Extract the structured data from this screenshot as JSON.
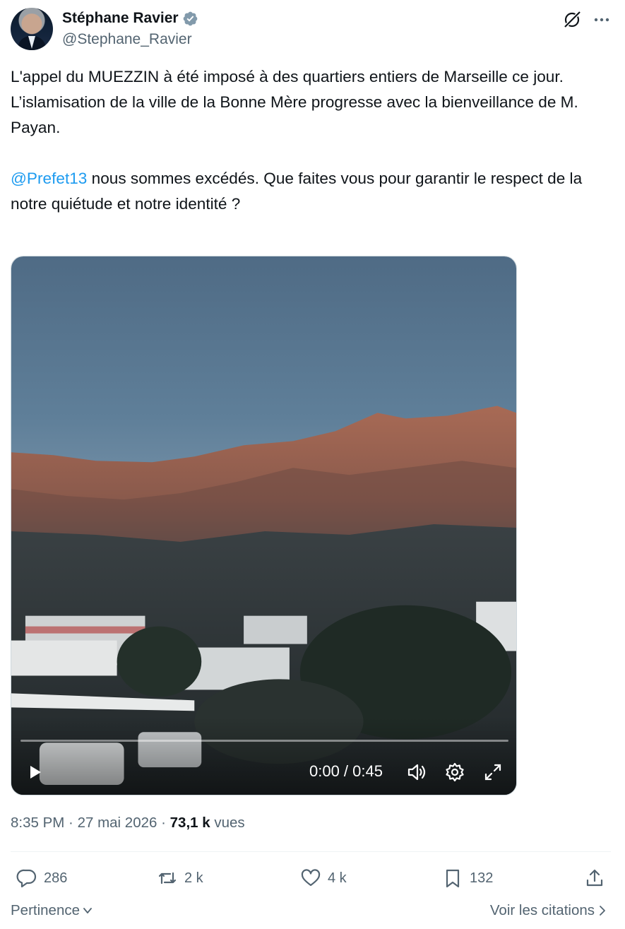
{
  "author": {
    "display_name": "Stéphane Ravier",
    "handle": "@Stephane_Ravier",
    "verified": true
  },
  "header_icons": [
    "grok-icon",
    "more-icon"
  ],
  "tweet": {
    "paragraph1": "L'appel du MUEZZIN à été imposé à des quartiers entiers de Marseille ce jour.\nL’islamisation de la ville de la Bonne Mère progresse avec la bienveillance de M. Payan.",
    "mention": "@Prefet13",
    "paragraph2": " nous sommes excédés. Que faites vous pour garantir le respect de la notre quiétude et notre identité ?"
  },
  "video": {
    "time": "0:00 / 0:45",
    "progress": 0.0,
    "controls": [
      "play-icon",
      "volume-icon",
      "settings-icon",
      "fullscreen-icon"
    ]
  },
  "meta": {
    "time": "8:35 PM",
    "sep1": " · ",
    "date": "27 mai 2026",
    "sep2": " · ",
    "views": "73,1 k",
    "views_label": " vues"
  },
  "actions": {
    "replies": "286",
    "reposts": "2 k",
    "likes": "4 k",
    "bookmarks": "132"
  },
  "footer": {
    "sort_label": "Pertinence",
    "quotes_label": "Voir les citations"
  },
  "colors": {
    "accent": "#1d9bf0",
    "text": "#0f1419",
    "muted": "#536471"
  }
}
